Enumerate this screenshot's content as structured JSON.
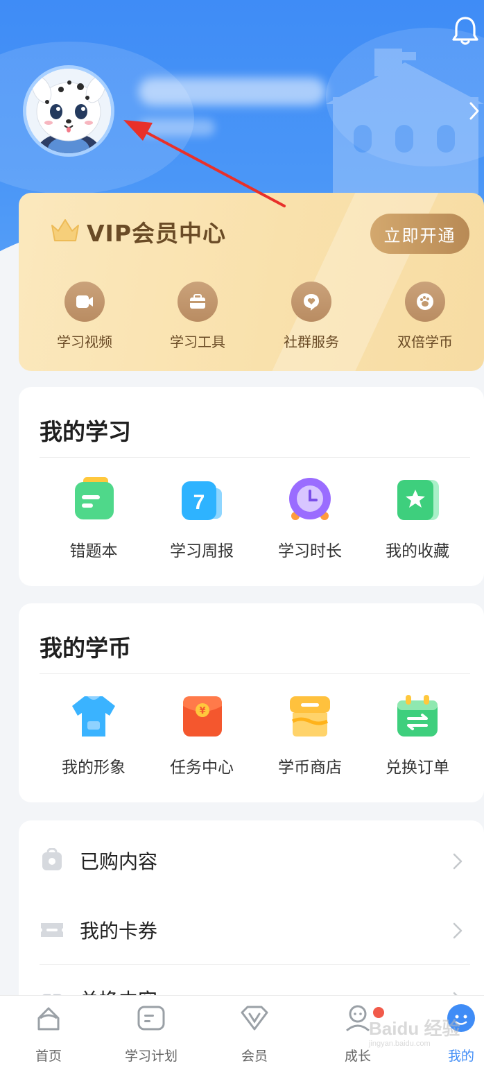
{
  "vip": {
    "title": "VIP会员中心",
    "open_button": "立即开通",
    "items": [
      {
        "label": "学习视频",
        "icon": "video-icon"
      },
      {
        "label": "学习工具",
        "icon": "toolbox-icon"
      },
      {
        "label": "社群服务",
        "icon": "heart-chat-icon"
      },
      {
        "label": "双倍学币",
        "icon": "paw-coin-icon"
      }
    ]
  },
  "my_study": {
    "title": "我的学习",
    "items": [
      {
        "label": "错题本",
        "icon": "mistake-notebook-icon"
      },
      {
        "label": "学习周报",
        "icon": "weekly-report-icon"
      },
      {
        "label": "学习时长",
        "icon": "alarm-clock-icon"
      },
      {
        "label": "我的收藏",
        "icon": "star-favorite-icon"
      }
    ]
  },
  "my_coins": {
    "title": "我的学币",
    "items": [
      {
        "label": "我的形象",
        "icon": "tshirt-icon"
      },
      {
        "label": "任务中心",
        "icon": "red-envelope-icon"
      },
      {
        "label": "学币商店",
        "icon": "shop-icon"
      },
      {
        "label": "兑换订单",
        "icon": "exchange-calendar-icon"
      }
    ]
  },
  "list": {
    "items": [
      {
        "label": "已购内容",
        "icon": "purchased-bag-icon"
      },
      {
        "label": "我的卡券",
        "icon": "coupon-icon"
      },
      {
        "label": "兑换内容",
        "icon": "gift-icon"
      }
    ]
  },
  "tabbar": {
    "items": [
      {
        "label": "首页",
        "icon": "home-icon"
      },
      {
        "label": "学习计划",
        "icon": "plan-icon"
      },
      {
        "label": "会员",
        "icon": "vip-diamond-icon"
      },
      {
        "label": "成长",
        "icon": "growth-icon"
      },
      {
        "label": "我的",
        "icon": "profile-icon"
      }
    ],
    "active": "我的"
  },
  "watermark": "Baidu 经验",
  "watermark_url": "jingyan.baidu.com",
  "colors": {
    "header_blue": "#3f8cf6",
    "vip_gold": "#f9e1ac",
    "vip_text": "#6a4b26",
    "badge_red": "#f15a4a",
    "annotation_red": "#e8302a"
  }
}
